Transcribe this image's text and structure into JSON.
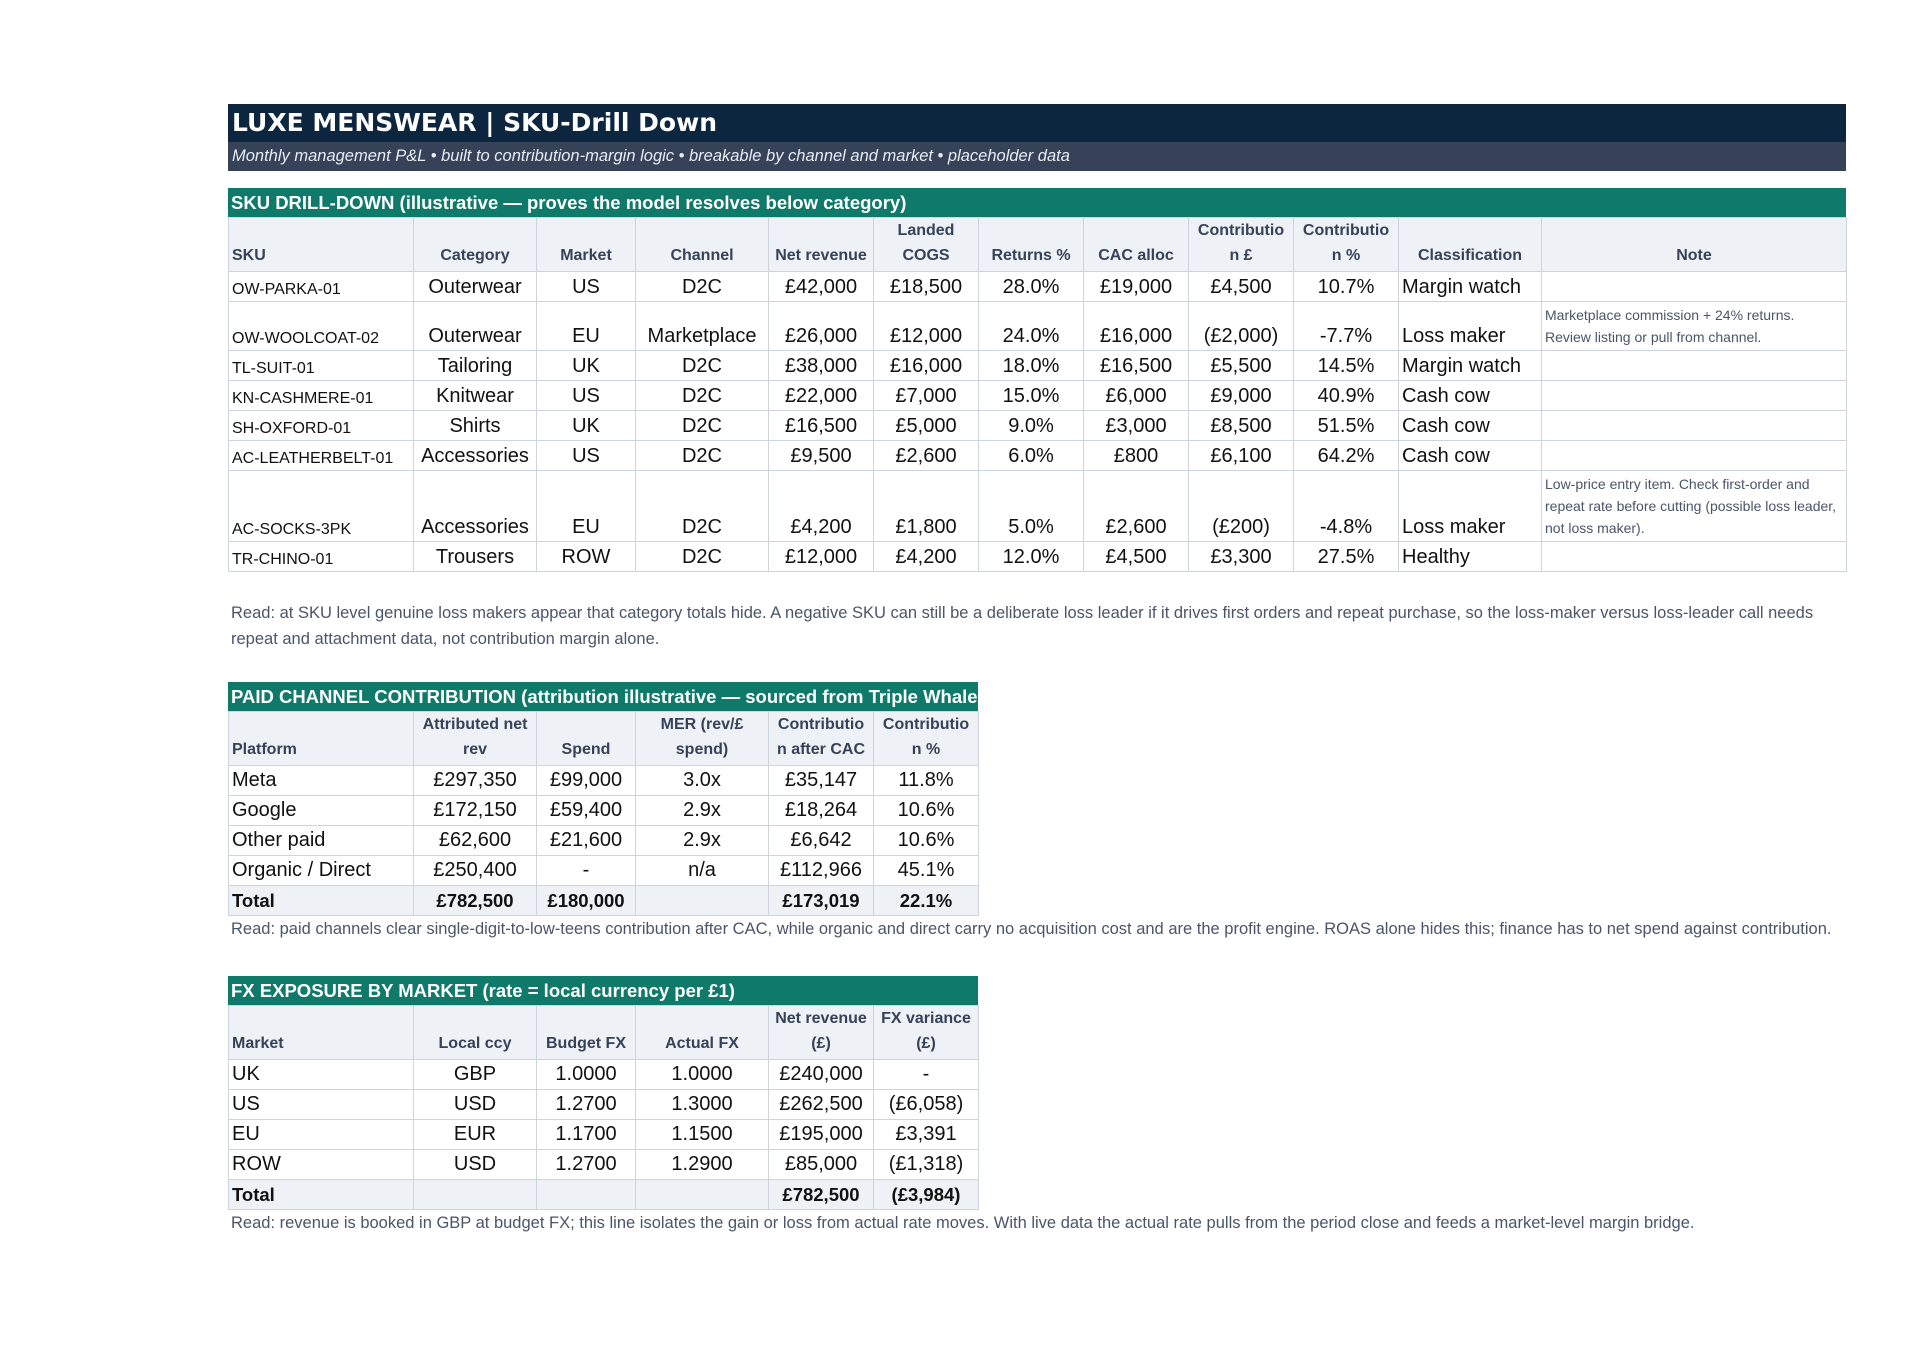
{
  "header": {
    "title": "LUXE MENSWEAR  |  SKU-Drill Down",
    "subtitle": "Monthly management P&L  •  built to contribution-margin logic  •  breakable by channel and market  •  placeholder data"
  },
  "sku": {
    "section_title": "SKU DRILL-DOWN   (illustrative — proves the model resolves below category)",
    "columns": [
      "SKU",
      "Category",
      "Market",
      "Channel",
      "Net revenue",
      "Landed COGS",
      "Returns %",
      "CAC alloc",
      "Contributio n £",
      "Contributio n %",
      "Classification",
      "Note"
    ],
    "rows": [
      [
        "OW-PARKA-01",
        "Outerwear",
        "US",
        "D2C",
        "£42,000",
        "£18,500",
        "28.0%",
        "£19,000",
        "£4,500",
        "10.7%",
        "Margin watch",
        ""
      ],
      [
        "OW-WOOLCOAT-02",
        "Outerwear",
        "EU",
        "Marketplace",
        "£26,000",
        "£12,000",
        "24.0%",
        "£16,000",
        "(£2,000)",
        "-7.7%",
        "Loss maker",
        "Marketplace commission + 24% returns. Review listing or pull from channel."
      ],
      [
        "TL-SUIT-01",
        "Tailoring",
        "UK",
        "D2C",
        "£38,000",
        "£16,000",
        "18.0%",
        "£16,500",
        "£5,500",
        "14.5%",
        "Margin watch",
        ""
      ],
      [
        "KN-CASHMERE-01",
        "Knitwear",
        "US",
        "D2C",
        "£22,000",
        "£7,000",
        "15.0%",
        "£6,000",
        "£9,000",
        "40.9%",
        "Cash cow",
        ""
      ],
      [
        "SH-OXFORD-01",
        "Shirts",
        "UK",
        "D2C",
        "£16,500",
        "£5,000",
        "9.0%",
        "£3,000",
        "£8,500",
        "51.5%",
        "Cash cow",
        ""
      ],
      [
        "AC-LEATHERBELT-01",
        "Accessories",
        "US",
        "D2C",
        "£9,500",
        "£2,600",
        "6.0%",
        "£800",
        "£6,100",
        "64.2%",
        "Cash cow",
        ""
      ],
      [
        "AC-SOCKS-3PK",
        "Accessories",
        "EU",
        "D2C",
        "£4,200",
        "£1,800",
        "5.0%",
        "£2,600",
        "(£200)",
        "-4.8%",
        "Loss maker",
        "Low-price entry item. Check first-order and repeat rate before cutting (possible loss leader, not loss maker)."
      ],
      [
        "TR-CHINO-01",
        "Trousers",
        "ROW",
        "D2C",
        "£12,000",
        "£4,200",
        "12.0%",
        "£4,500",
        "£3,300",
        "27.5%",
        "Healthy",
        ""
      ]
    ],
    "read": "Read: at SKU level genuine loss makers appear that category totals hide. A negative SKU can still be a deliberate loss leader if it drives first orders and repeat purchase, so the loss-maker versus loss-leader call needs repeat and attachment data, not contribution margin alone."
  },
  "paid": {
    "section_title": "PAID CHANNEL CONTRIBUTION   (attribution illustrative — sourced from Triple Whale",
    "columns": [
      "Platform",
      "Attributed net rev",
      "Spend",
      "MER (rev/£ spend)",
      "Contributio n after CAC",
      "Contributio n %"
    ],
    "rows": [
      [
        "Meta",
        "£297,350",
        "£99,000",
        "3.0x",
        "£35,147",
        "11.8%"
      ],
      [
        "Google",
        "£172,150",
        "£59,400",
        "2.9x",
        "£18,264",
        "10.6%"
      ],
      [
        "Other paid",
        "£62,600",
        "£21,600",
        "2.9x",
        "£6,642",
        "10.6%"
      ],
      [
        "Organic / Direct",
        "£250,400",
        "-",
        "n/a",
        "£112,966",
        "45.1%"
      ]
    ],
    "total": [
      "Total",
      "£782,500",
      "£180,000",
      "",
      "£173,019",
      "22.1%"
    ],
    "read": "Read: paid channels clear single-digit-to-low-teens contribution after CAC, while organic and direct carry no acquisition cost and are the profit engine. ROAS alone hides this; finance has to net spend against contribution."
  },
  "fx": {
    "section_title": "FX EXPOSURE BY MARKET   (rate = local currency per £1)",
    "columns": [
      "Market",
      "Local ccy",
      "Budget FX",
      "Actual FX",
      "Net revenue (£)",
      "FX variance (£)"
    ],
    "rows": [
      [
        "UK",
        "GBP",
        "1.0000",
        "1.0000",
        "£240,000",
        "-"
      ],
      [
        "US",
        "USD",
        "1.2700",
        "1.3000",
        "£262,500",
        "(£6,058)"
      ],
      [
        "EU",
        "EUR",
        "1.1700",
        "1.1500",
        "£195,000",
        "£3,391"
      ],
      [
        "ROW",
        "USD",
        "1.2700",
        "1.2900",
        "£85,000",
        "(£1,318)"
      ]
    ],
    "total": [
      "Total",
      "",
      "",
      "",
      "£782,500",
      "(£3,984)"
    ],
    "read": "Read: revenue is booked in GBP at budget FX; this line isolates the gain or loss from actual rate moves. With live data the actual rate pulls from the period close and feeds a market-level margin bridge."
  }
}
